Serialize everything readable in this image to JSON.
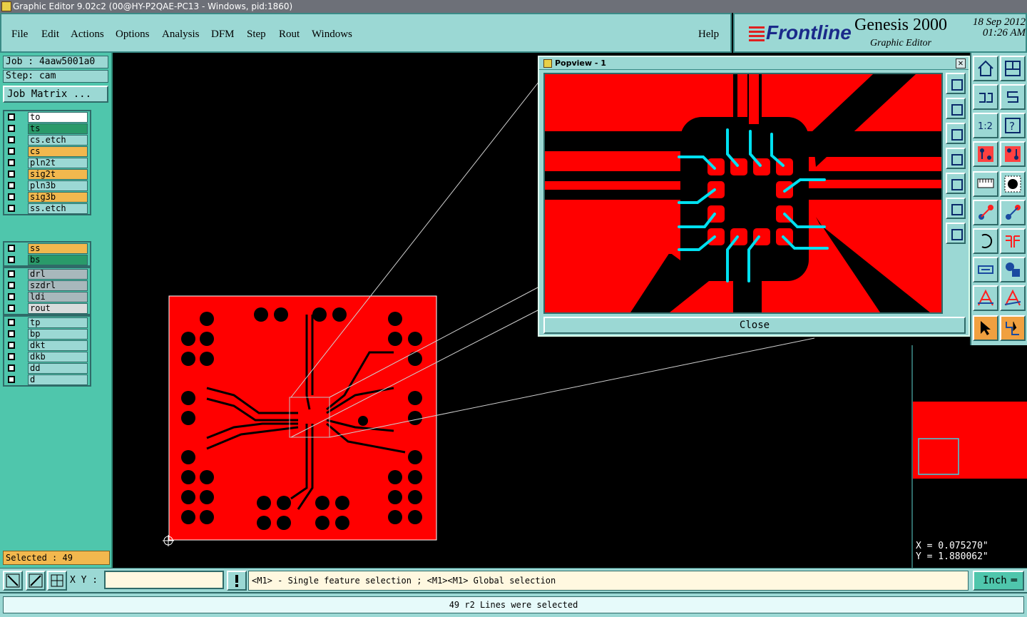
{
  "window": {
    "title": "Graphic Editor 9.02c2 (00@HY-P2QAE-PC13 - Windows, pid:1860)"
  },
  "menu": {
    "items": [
      "File",
      "Edit",
      "Actions",
      "Options",
      "Analysis",
      "DFM",
      "Step",
      "Rout",
      "Windows"
    ],
    "help": "Help"
  },
  "brand": {
    "logo": "Frontline",
    "product": "Genesis 2000",
    "subtitle": "Graphic Editor",
    "date": "18 Sep 2012",
    "time": "01:26 AM"
  },
  "job": {
    "job_line": "Job : 4aaw5001a0",
    "step_line": "Step: cam",
    "matrix_button": "Job Matrix ..."
  },
  "layers": {
    "group1": [
      {
        "name": "to",
        "color": "#ffffff"
      },
      {
        "name": "ts",
        "color": "#2a9a6a"
      },
      {
        "name": "cs.etch",
        "color": "#9bd8d4"
      },
      {
        "name": "cs",
        "color": "#f2b84e"
      },
      {
        "name": "pln2t",
        "color": "#9bd8d4"
      },
      {
        "name": "sig2t",
        "color": "#f2b84e"
      },
      {
        "name": "pln3b",
        "color": "#9bd8d4"
      },
      {
        "name": "sig3b",
        "color": "#f2b84e"
      },
      {
        "name": "ss.etch",
        "color": "#9bd8d4"
      }
    ],
    "group2": [
      {
        "name": "ss",
        "color": "#f2b84e"
      },
      {
        "name": "bs",
        "color": "#2a9a6a"
      }
    ],
    "group3": [
      {
        "name": "drl",
        "color": "#a8b8bc"
      },
      {
        "name": "szdrl",
        "color": "#a8b8bc"
      },
      {
        "name": "ldi",
        "color": "#a8b8bc"
      },
      {
        "name": "rout",
        "color": "#d8dcdc"
      }
    ],
    "group4": [
      {
        "name": "tp",
        "color": "#9bd8d4"
      },
      {
        "name": "bp",
        "color": "#9bd8d4"
      },
      {
        "name": "dkt",
        "color": "#9bd8d4"
      },
      {
        "name": "dkb",
        "color": "#9bd8d4"
      },
      {
        "name": "dd",
        "color": "#9bd8d4"
      },
      {
        "name": "d",
        "color": "#9bd8d4"
      }
    ]
  },
  "selected": "Selected : 49",
  "popview": {
    "title": "Popview - 1",
    "close_label": "Close"
  },
  "coords": {
    "x": "X = 0.075270\"",
    "y": "Y = 1.880062\""
  },
  "bottom": {
    "xy_label": "X Y :",
    "xy_value": "",
    "hint": "<M1> - Single feature selection ; <M1><M1> Global selection",
    "unit": "Inch"
  },
  "status": "49 r2 Lines were selected",
  "colors": {
    "copper": "#ff0000",
    "selection": "#00e0f0",
    "panel": "#9bd8d4",
    "accent": "#4fc6ac"
  }
}
